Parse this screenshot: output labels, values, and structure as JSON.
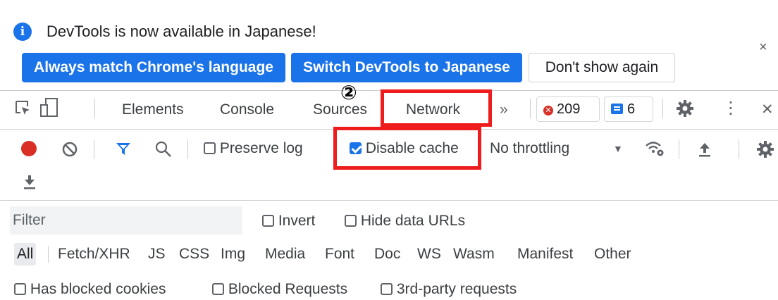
{
  "infobar": {
    "icon": "info-icon",
    "message": "DevTools is now available in Japanese!",
    "buttons": {
      "match": "Always match Chrome's language",
      "switch": "Switch DevTools to Japanese",
      "dont_show": "Don't show again"
    },
    "close": "×"
  },
  "toolbar": {
    "tabs": [
      "Elements",
      "Console",
      "Sources",
      "Network"
    ],
    "more": "»",
    "errors": "209",
    "messages": "6",
    "kebab": "⋮",
    "close": "✕",
    "annotation_number": "②"
  },
  "network": {
    "preserve_log": "Preserve log",
    "preserve_log_checked": false,
    "disable_cache": "Disable cache",
    "disable_cache_checked": true,
    "throttling": "No throttling"
  },
  "filter": {
    "placeholder": "Filter",
    "invert": "Invert",
    "hide_data_urls": "Hide data URLs",
    "types": [
      "All",
      "Fetch/XHR",
      "JS",
      "CSS",
      "Img",
      "Media",
      "Font",
      "Doc",
      "WS",
      "Wasm",
      "Manifest",
      "Other"
    ],
    "has_blocked_cookies": "Has blocked cookies",
    "blocked_requests": "Blocked Requests",
    "third_party": "3rd-party requests"
  },
  "colors": {
    "accent": "#1a73e8",
    "highlight": "#ee1c1c",
    "record": "#d93025"
  }
}
